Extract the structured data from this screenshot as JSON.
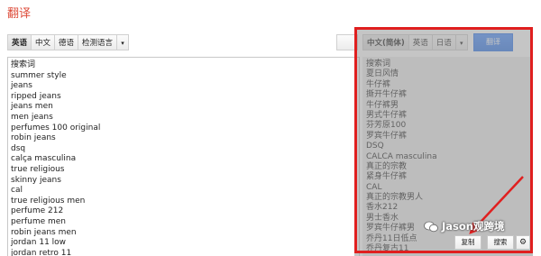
{
  "header": {
    "title": "翻译"
  },
  "source_lang_bar": {
    "buttons": [
      "英语",
      "中文",
      "德语",
      "检测语言"
    ],
    "dropdown_glyph": "▾"
  },
  "target_lang_bar": {
    "buttons": [
      "中文(简体)",
      "英语",
      "日语"
    ],
    "dropdown_glyph": "▾"
  },
  "translate_button": "翻译",
  "source_text": [
    "搜索词",
    "summer style",
    "jeans",
    "ripped jeans",
    "jeans men",
    "men jeans",
    "perfumes 100 original",
    "robin jeans",
    "dsq",
    "calça masculina",
    "true religious",
    "skinny jeans",
    "cal",
    "true religious men",
    "perfume 212",
    "perfume men",
    "robin jeans men",
    "jordan 11 low",
    "jordan retro 11"
  ],
  "result_text": [
    "搜索词",
    "夏日风情",
    "牛仔裤",
    "撕开牛仔裤",
    "牛仔裤男",
    "男式牛仔裤",
    "芬芳原100",
    "罗宾牛仔裤",
    "DSQ",
    "CALCA masculina",
    "真正的宗教",
    "紧身牛仔裤",
    "CAL",
    "真正的宗教男人",
    "香水212",
    "男士香水",
    "罗宾牛仔裤男",
    "乔丹11日低点",
    "乔丹复古11"
  ],
  "actions": {
    "copy": "复制",
    "search": "搜索",
    "settings_glyph": "⚙"
  },
  "watermark": {
    "text": "Jason观跨境"
  },
  "colors": {
    "title": "#dd4b39",
    "translate_button": "#4d90fe",
    "highlight_frame": "#e01f1f"
  }
}
